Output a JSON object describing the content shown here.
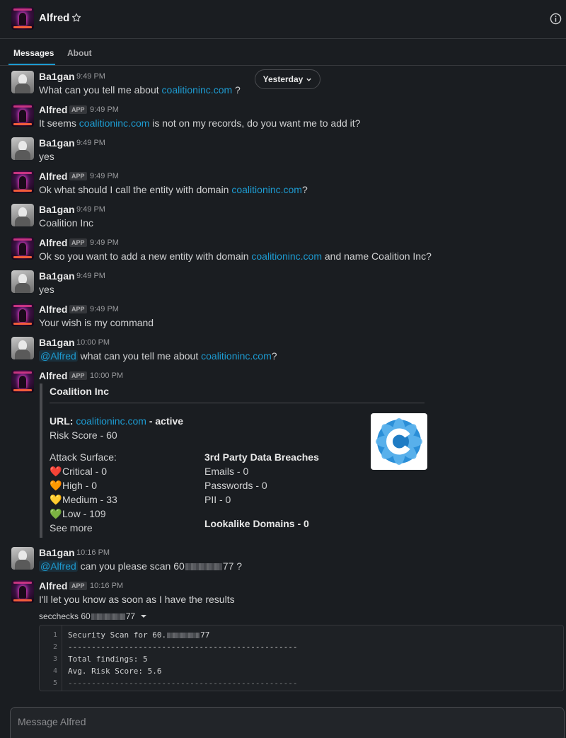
{
  "header": {
    "channel_title": "Alfred",
    "star_icon": "star-icon",
    "info_icon": "info-icon"
  },
  "tabs": [
    {
      "label": "Messages",
      "active": true
    },
    {
      "label": "About",
      "active": false
    }
  ],
  "date_pill": {
    "label": "Yesterday"
  },
  "messages": [
    {
      "user": "Ba1gan",
      "time": "9:49 PM",
      "pre": "What can you tell me about ",
      "link": "coalitioninc.com",
      "post": " ?"
    },
    {
      "user": "Alfred",
      "app": "APP",
      "time": "9:49 PM",
      "pre": "It seems ",
      "link": "coalitioninc.com",
      "post": " is not on my records, do you want me to add it?"
    },
    {
      "user": "Ba1gan",
      "time": "9:49 PM",
      "text": "yes"
    },
    {
      "user": "Alfred",
      "app": "APP",
      "time": "9:49 PM",
      "pre": "Ok what should I call the entity with domain ",
      "link": "coalitioninc.com",
      "post": "?"
    },
    {
      "user": "Ba1gan",
      "time": "9:49 PM",
      "text": "Coalition Inc"
    },
    {
      "user": "Alfred",
      "app": "APP",
      "time": "9:49 PM",
      "pre": "Ok so you want to add a new entity with domain ",
      "link": "coalitioninc.com",
      "post": " and name Coalition Inc?"
    },
    {
      "user": "Ba1gan",
      "time": "9:49 PM",
      "text": "yes"
    },
    {
      "user": "Alfred",
      "app": "APP",
      "time": "9:49 PM",
      "text": "Your wish is my command"
    },
    {
      "user": "Ba1gan",
      "time": "10:00 PM",
      "mention": "@Alfred",
      "pre": " what can you tell me about ",
      "link": "coalitioninc.com",
      "post": "?"
    },
    {
      "user": "Alfred",
      "app": "APP",
      "time": "10:00 PM"
    },
    {
      "user": "Ba1gan",
      "time": "10:16 PM",
      "mention": "@Alfred",
      "pre": " can you please scan 60",
      "post": "77 ?"
    },
    {
      "user": "Alfred",
      "app": "APP",
      "time": "10:16 PM",
      "text": "I'll let you know as soon as I have the results"
    }
  ],
  "attachment": {
    "title": "Coalition Inc",
    "url_label": "URL:",
    "url_link": "coalitioninc.com",
    "url_status": " - active",
    "risk_score": "Risk Score - 60",
    "attack_surface_label": "Attack Surface:",
    "attack_items": [
      {
        "icon": "red-heart-icon",
        "glyph": "❤️",
        "color": "#dd2e44",
        "label": "Critical - 0"
      },
      {
        "icon": "orange-heart-icon",
        "glyph": "🧡",
        "color": "#f4900c",
        "label": "High - 0"
      },
      {
        "icon": "yellow-heart-icon",
        "glyph": "💛",
        "color": "#fdcb58",
        "label": "Medium - 33"
      },
      {
        "icon": "green-heart-icon",
        "glyph": "💚",
        "color": "#78b159",
        "label": "Low - 109"
      }
    ],
    "see_more": "See more",
    "breaches_label": "3rd Party Data Breaches",
    "breach_items": [
      "Emails - 0",
      "Passwords - 0",
      "PII - 0"
    ],
    "lookalike": "Lookalike Domains - 0",
    "logo_icon": "coalition-logo-icon"
  },
  "snippet": {
    "title_pre": "secchecks 60",
    "title_post": "77",
    "lines": [
      {
        "n": "1",
        "pre": "Security Scan for 60.",
        "post": "77"
      },
      {
        "n": "2",
        "text": "-------------------------------------------------"
      },
      {
        "n": "3",
        "text": "Total findings: 5"
      },
      {
        "n": "4",
        "text": "Avg. Risk Score: 5.6"
      },
      {
        "n": "5",
        "text": "-------------------------------------------------"
      }
    ]
  },
  "composer": {
    "placeholder": "Message Alfred"
  },
  "colors": {
    "link": "#1d9bd1",
    "background": "#1a1d21"
  }
}
